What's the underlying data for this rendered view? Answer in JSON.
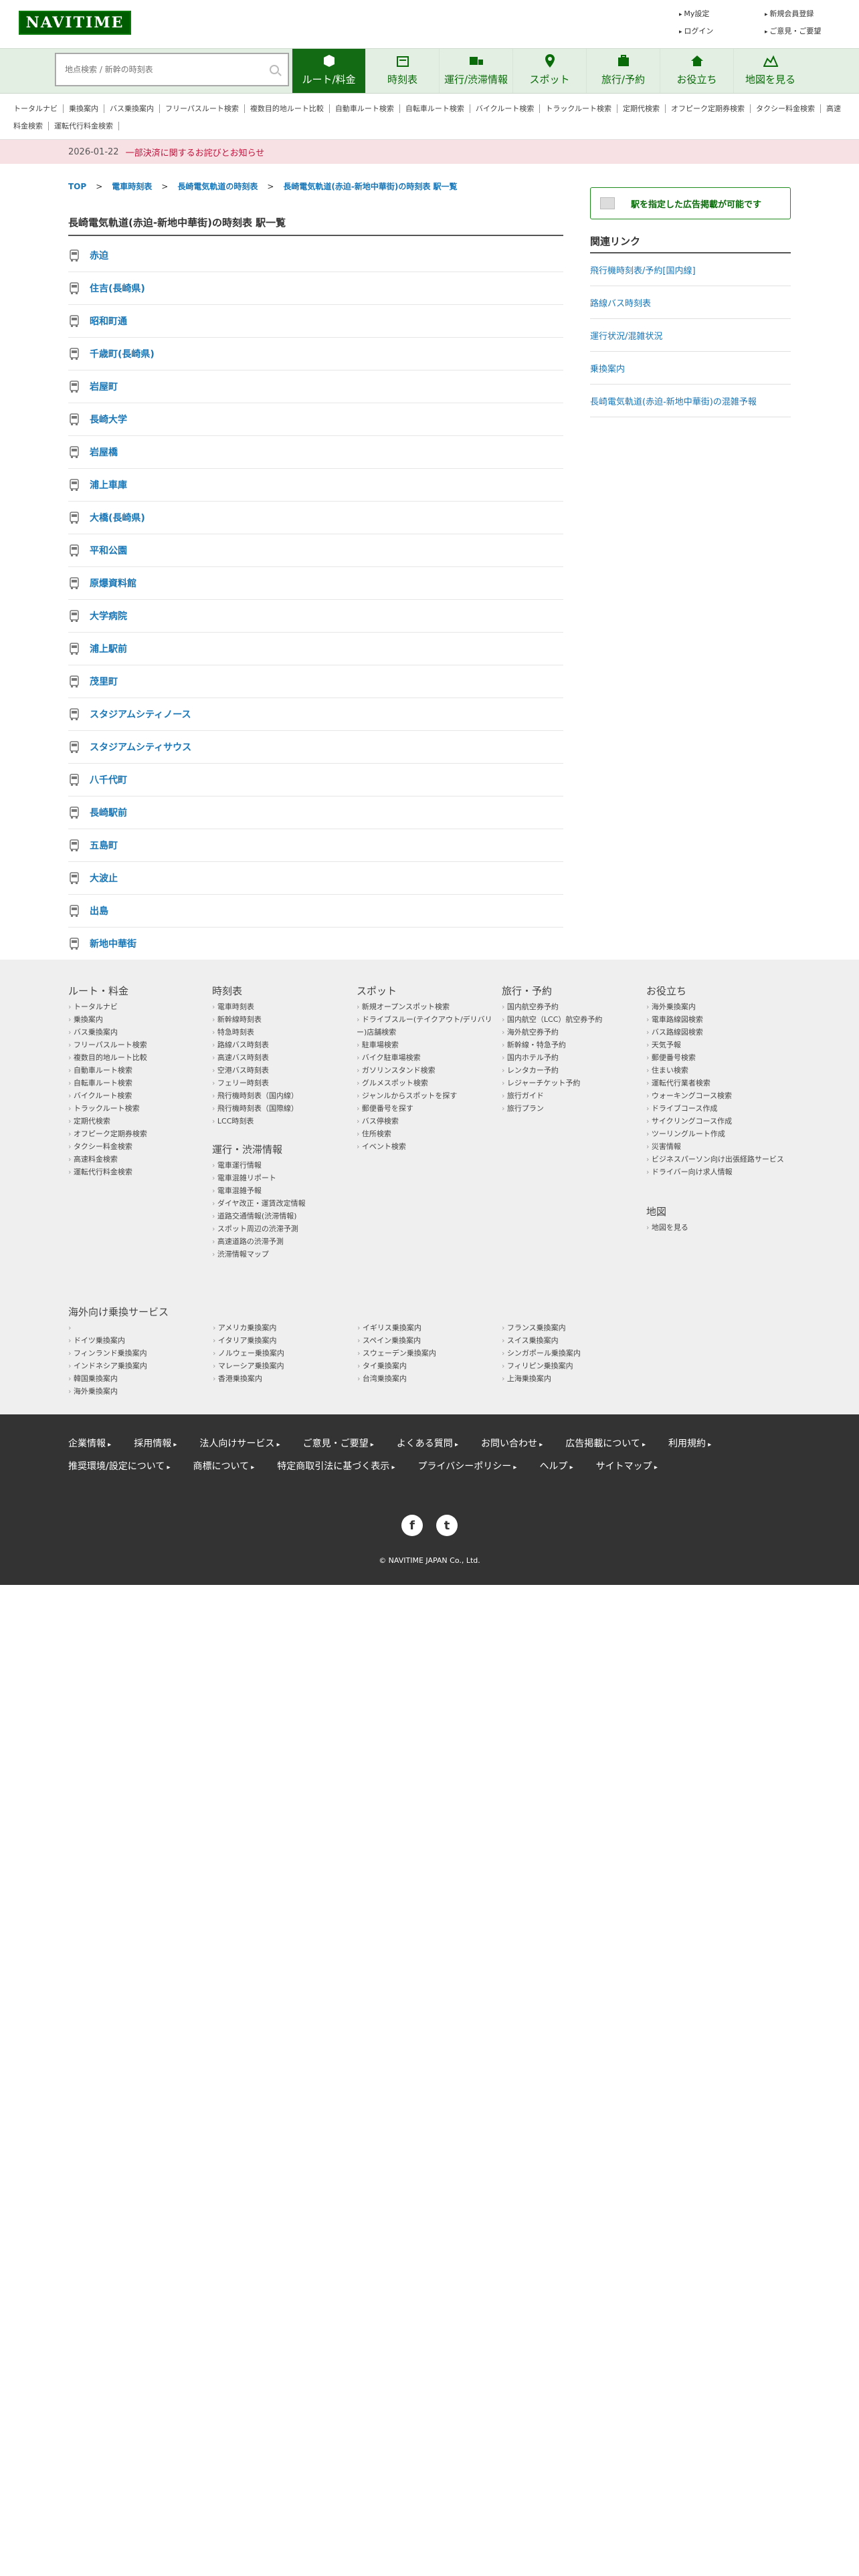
{
  "header": {
    "logo": "NAVITIME",
    "links": [
      "My設定",
      "新規会員登録",
      "ログイン",
      "ご意見・ご要望"
    ]
  },
  "nav": {
    "search_placeholder": "地点検索 / 新幹の時刻表",
    "tabs": [
      {
        "label": "ルート/料金",
        "icon": "cube-icon",
        "active": true
      },
      {
        "label": "時刻表",
        "icon": "calendar-icon"
      },
      {
        "label": "運行/渋滞情報",
        "icon": "train-car-icon"
      },
      {
        "label": "スポット",
        "icon": "pin-icon"
      },
      {
        "label": "旅行/予約",
        "icon": "suitcase-icon"
      },
      {
        "label": "お役立ち",
        "icon": "house-icon"
      },
      {
        "label": "地図を見る",
        "icon": "map-icon"
      }
    ],
    "sublinks": [
      "トータルナビ",
      "乗換案内",
      "バス乗換案内",
      "フリーパスルート検索",
      "複数目的地ルート比較",
      "自動車ルート検索",
      "自転車ルート検索",
      "バイクルート検索",
      "トラックルート検索",
      "定期代検索",
      "オフピーク定期券検索",
      "タクシー料金検索",
      "高速料金検索",
      "運転代行料金検索"
    ]
  },
  "notice": {
    "date": "2026-01-22",
    "text": "一部決済に関するお詫びとお知らせ"
  },
  "breadcrumb": [
    "TOP",
    "電車時刻表",
    "長崎電気軌道の時刻表",
    "長崎電気軌道(赤迫-新地中華街)の時刻表 駅一覧"
  ],
  "page_title": "長崎電気軌道(赤迫-新地中華街)の時刻表 駅一覧",
  "stations": [
    "赤迫",
    "住吉(長崎県)",
    "昭和町通",
    "千歳町(長崎県)",
    "岩屋町",
    "長崎大学",
    "岩屋橋",
    "浦上車庫",
    "大橋(長崎県)",
    "平和公園",
    "原爆資料館",
    "大学病院",
    "浦上駅前",
    "茂里町",
    "スタジアムシティノース",
    "スタジアムシティサウス",
    "八千代町",
    "長崎駅前",
    "五島町",
    "大波止",
    "出島",
    "新地中華街"
  ],
  "sidebar": {
    "ad_label": "駅を指定した広告掲載が可能です",
    "related_title": "関連リンク",
    "related": [
      "飛行機時刻表/予約[国内線]",
      "路線バス時刻表",
      "運行状況/混雑状況",
      "乗換案内",
      "長崎電気軌道(赤迫-新地中華街)の混雑予報"
    ]
  },
  "footer": {
    "col1": {
      "title": "ルート・料金",
      "items": [
        "トータルナビ",
        "乗換案内",
        "バス乗換案内",
        "フリーパスルート検索",
        "複数目的地ルート比較",
        "自動車ルート検索",
        "自転車ルート検索",
        "バイクルート検索",
        "トラックルート検索",
        "定期代検索",
        "オフピーク定期券検索",
        "タクシー料金検索",
        "高速料金検索",
        "運転代行料金検索"
      ]
    },
    "col2": {
      "title": "時刻表",
      "items": [
        "電車時刻表",
        "新幹線時刻表",
        "特急時刻表",
        "路線バス時刻表",
        "高速バス時刻表",
        "空港バス時刻表",
        "フェリー時刻表",
        "飛行機時刻表（国内線）",
        "飛行機時刻表（国際線）",
        "LCC時刻表"
      ]
    },
    "col2b": {
      "title": "運行・渋滞情報",
      "items": [
        "電車運行情報",
        "電車混雑リポート",
        "電車混雑予報",
        "ダイヤ改正・運賃改定情報",
        "道路交通情報(渋滞情報)",
        "スポット周辺の渋滞予測",
        "高速道路の渋滞予測",
        "渋滞情報マップ"
      ]
    },
    "col3": {
      "title": "スポット",
      "items": [
        "新規オープンスポット検索",
        "ドライブスルー(テイクアウト/デリバリー)店舗検索",
        "駐車場検索",
        "バイク駐車場検索",
        "ガソリンスタンド検索",
        "グルメスポット検索",
        "ジャンルからスポットを探す",
        "郵便番号を探す",
        "バス停検索",
        "住所検索",
        "イベント検索"
      ]
    },
    "col4": {
      "title": "旅行・予約",
      "items": [
        "国内航空券予約",
        "国内航空（LCC）航空券予約",
        "海外航空券予約",
        "新幹線・特急予約",
        "国内ホテル予約",
        "レンタカー予約",
        "レジャーチケット予約",
        "旅行ガイド",
        "旅行プラン"
      ]
    },
    "col5": {
      "title": "お役立ち",
      "items": [
        "海外乗換案内",
        "電車路線図検索",
        "バス路線図検索",
        "天気予報",
        "郵便番号検索",
        "住まい検索",
        "運転代行業者検索",
        "ウォーキングコース検索",
        "ドライブコース作成",
        "サイクリングコース作成",
        "ツーリングルート作成",
        "災害情報",
        "ビジネスパーソン向け出張経路サービス",
        "ドライバー向け求人情報"
      ]
    },
    "col5b": {
      "title": "地図",
      "items": [
        "地図を見る"
      ]
    },
    "overseas": {
      "title": "海外向け乗換サービス",
      "items": [
        "アメリカ乗換案内",
        "イギリス乗換案内",
        "フランス乗換案内",
        "ドイツ乗換案内",
        "イタリア乗換案内",
        "スペイン乗換案内",
        "スイス乗換案内",
        "フィンランド乗換案内",
        "ノルウェー乗換案内",
        "スウェーデン乗換案内",
        "シンガポール乗換案内",
        "インドネシア乗換案内",
        "マレーシア乗換案内",
        "タイ乗換案内",
        "フィリピン乗換案内",
        "韓国乗換案内",
        "香港乗換案内",
        "台湾乗換案内",
        "上海乗換案内",
        "海外乗換案内"
      ]
    }
  },
  "bottom": {
    "links": [
      "企業情報",
      "採用情報",
      "法人向けサービス",
      "ご意見・ご要望",
      "よくある質問",
      "お問い合わせ",
      "広告掲載について",
      "利用規約",
      "推奨環境/設定について",
      "商標について",
      "特定商取引法に基づく表示",
      "プライバシーポリシー",
      "ヘルプ",
      "サイトマップ"
    ],
    "social": [
      "facebook-icon",
      "twitter-icon"
    ],
    "copyright": "© NAVITIME JAPAN Co., Ltd."
  }
}
